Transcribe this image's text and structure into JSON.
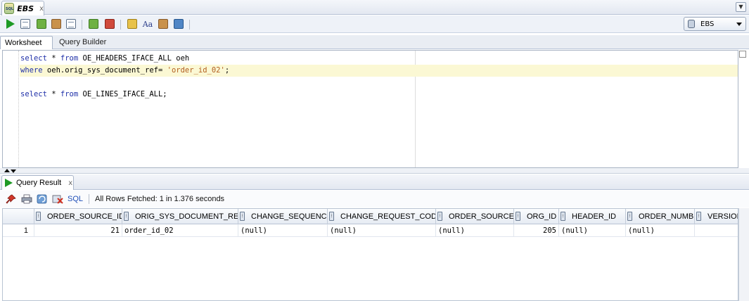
{
  "document_tab": {
    "label": "EBS",
    "close": "x"
  },
  "tab_menu": {
    "icon": "chevron-down-icon",
    "glyph": "▼"
  },
  "toolbar": {
    "connection": "EBS",
    "icons": [
      "run-statement-icon",
      "run-script-icon",
      "autotrace-icon",
      "explain-plan-icon",
      "sql-tuning-icon",
      "commit-icon",
      "rollback-icon",
      "sql-history-icon",
      "format-icon",
      "clear-icon",
      "sql-monitor-icon"
    ]
  },
  "sub_tabs": {
    "worksheet": "Worksheet",
    "query_builder": "Query Builder"
  },
  "editor": {
    "lines": [
      [
        {
          "t": "select",
          "c": "kw"
        },
        {
          "t": " * ",
          "c": ""
        },
        {
          "t": "from",
          "c": "kw"
        },
        {
          "t": " OE_HEADERS_IFACE_ALL oeh",
          "c": ""
        }
      ],
      [
        {
          "t": "where",
          "c": "kw"
        },
        {
          "t": " oeh.orig_sys_document_ref= ",
          "c": ""
        },
        {
          "t": "'order_id_02'",
          "c": "str"
        },
        {
          "t": ";",
          "c": ""
        }
      ],
      [],
      [
        {
          "t": "select",
          "c": "kw"
        },
        {
          "t": " * ",
          "c": ""
        },
        {
          "t": "from",
          "c": "kw"
        },
        {
          "t": " OE_LINES_IFACE_ALL;",
          "c": ""
        }
      ]
    ]
  },
  "result_tab": {
    "label": "Query Result",
    "close": "x"
  },
  "result_toolbar": {
    "sql_label": "SQL",
    "status": "All Rows Fetched: 1 in 1.376 seconds",
    "icons": [
      "pin-icon",
      "print-icon",
      "refresh-icon",
      "delete-icon"
    ]
  },
  "grid": {
    "columns": [
      "ORDER_SOURCE_ID",
      "ORIG_SYS_DOCUMENT_REF",
      "CHANGE_SEQUENCE",
      "CHANGE_REQUEST_CODE",
      "ORDER_SOURCE",
      "ORG_ID",
      "HEADER_ID",
      "ORDER_NUMBER",
      "VERSION"
    ],
    "rows": [
      {
        "row_number": "1",
        "cells": [
          "21",
          "order_id_02",
          "(null)",
          "(null)",
          "(null)",
          "205",
          "(null)",
          "(null)",
          ""
        ]
      }
    ]
  }
}
